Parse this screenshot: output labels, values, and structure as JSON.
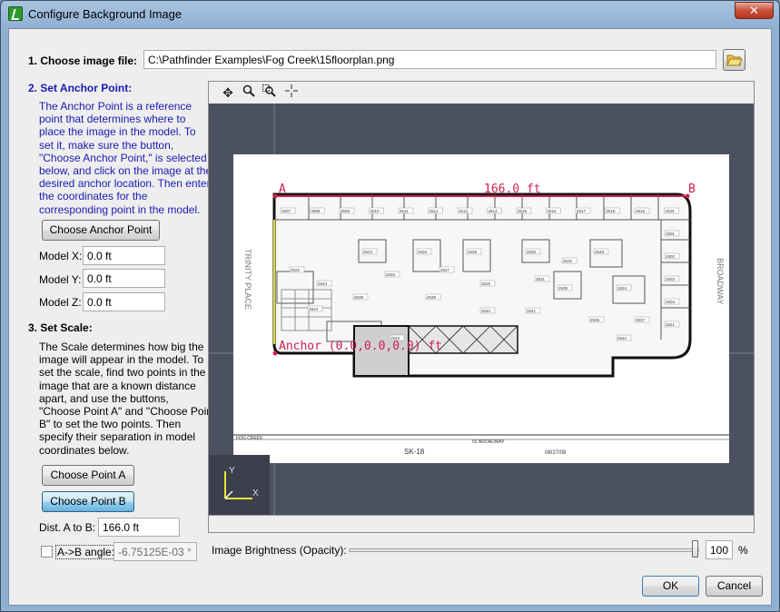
{
  "window": {
    "title": "Configure Background Image",
    "close_label": "✕"
  },
  "step1": {
    "label": "1. Choose image file:",
    "file_path": "C:\\Pathfinder Examples\\Fog Creek\\15floorplan.png"
  },
  "step2": {
    "label": "2. Set Anchor Point:",
    "description": [
      "The Anchor Point is a reference",
      "point that determines where to",
      "place the image in the model.  To",
      "set it, make sure the button,",
      "\"Choose Anchor Point,\" is selected",
      "below, and click on the image at the",
      "desired anchor location.  Then enter",
      "the coordinates for the",
      "corresponding point in the model."
    ],
    "choose_button": "Choose Anchor Point",
    "model_x_label": "Model X:",
    "model_x": "0.0 ft",
    "model_y_label": "Model Y:",
    "model_y": "0.0 ft",
    "model_z_label": "Model Z:",
    "model_z": "0.0 ft"
  },
  "step3": {
    "label": "3. Set Scale:",
    "description": [
      "The Scale determines how big the",
      "image will appear in the model.  To",
      "set the scale, find two points in the",
      "image that are a known distance",
      "apart, and use the buttons,",
      "\"Choose Point A\" and \"Choose Point",
      "B\" to set the two points.  Then",
      "specify their separation in model",
      "coordinates below."
    ],
    "point_a_button": "Choose Point A",
    "point_b_button": "Choose Point B",
    "dist_label": "Dist. A to B:",
    "dist_value": "166.0 ft",
    "angle_label": "A->B angle:",
    "angle_value": "-6.75125E-03 °"
  },
  "viewer": {
    "tools": [
      "move-icon",
      "zoom-icon",
      "zoom-region-icon",
      "crosshair-icon"
    ],
    "overlay": {
      "point_a": "A",
      "point_b": "B",
      "distance": "166.0 ft",
      "anchor": "Anchor (0.0,0.0,0.0) ft"
    },
    "plan_text": {
      "street_left": "TRINITY PLACE",
      "street_right": "BROADWAY",
      "sheet": "SK-18",
      "address": "55 BROADWAY",
      "date": "08/27/08",
      "company": "FOG CREEK",
      "rooms": [
        "2507",
        "2508",
        "2509",
        "2510",
        "2511",
        "2512",
        "2513",
        "2514",
        "2515",
        "2516",
        "2517",
        "2518",
        "2519",
        "2520",
        "2501",
        "2502",
        "2503",
        "2504",
        "2521",
        "2522",
        "2523",
        "2524",
        "2525",
        "2526",
        "2527",
        "2528",
        "2529",
        "2530",
        "2531",
        "2532",
        "2533",
        "2534",
        "2535",
        "2536",
        "2537",
        "2538",
        "2539",
        "2540",
        "2541",
        "2542",
        "2543",
        "2544"
      ]
    },
    "axis": {
      "y": "Y",
      "x": "X"
    }
  },
  "brightness": {
    "label": "Image Brightness (Opacity):",
    "value": "100",
    "unit": "%",
    "level": 1.0
  },
  "footer": {
    "ok": "OK",
    "cancel": "Cancel"
  }
}
